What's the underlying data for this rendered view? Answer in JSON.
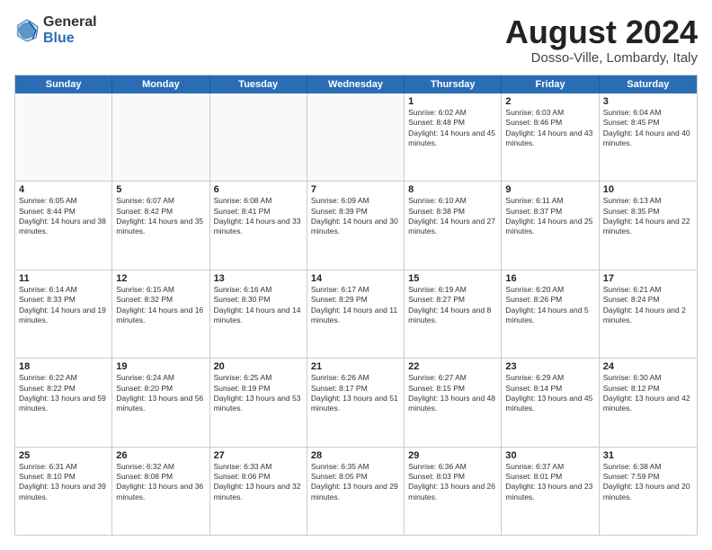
{
  "logo": {
    "general": "General",
    "blue": "Blue"
  },
  "title": {
    "month_year": "August 2024",
    "location": "Dosso-Ville, Lombardy, Italy"
  },
  "days_of_week": [
    "Sunday",
    "Monday",
    "Tuesday",
    "Wednesday",
    "Thursday",
    "Friday",
    "Saturday"
  ],
  "weeks": [
    [
      {
        "day": "",
        "text": ""
      },
      {
        "day": "",
        "text": ""
      },
      {
        "day": "",
        "text": ""
      },
      {
        "day": "",
        "text": ""
      },
      {
        "day": "1",
        "text": "Sunrise: 6:02 AM\nSunset: 8:48 PM\nDaylight: 14 hours and 45 minutes."
      },
      {
        "day": "2",
        "text": "Sunrise: 6:03 AM\nSunset: 8:46 PM\nDaylight: 14 hours and 43 minutes."
      },
      {
        "day": "3",
        "text": "Sunrise: 6:04 AM\nSunset: 8:45 PM\nDaylight: 14 hours and 40 minutes."
      }
    ],
    [
      {
        "day": "4",
        "text": "Sunrise: 6:05 AM\nSunset: 8:44 PM\nDaylight: 14 hours and 38 minutes."
      },
      {
        "day": "5",
        "text": "Sunrise: 6:07 AM\nSunset: 8:42 PM\nDaylight: 14 hours and 35 minutes."
      },
      {
        "day": "6",
        "text": "Sunrise: 6:08 AM\nSunset: 8:41 PM\nDaylight: 14 hours and 33 minutes."
      },
      {
        "day": "7",
        "text": "Sunrise: 6:09 AM\nSunset: 8:39 PM\nDaylight: 14 hours and 30 minutes."
      },
      {
        "day": "8",
        "text": "Sunrise: 6:10 AM\nSunset: 8:38 PM\nDaylight: 14 hours and 27 minutes."
      },
      {
        "day": "9",
        "text": "Sunrise: 6:11 AM\nSunset: 8:37 PM\nDaylight: 14 hours and 25 minutes."
      },
      {
        "day": "10",
        "text": "Sunrise: 6:13 AM\nSunset: 8:35 PM\nDaylight: 14 hours and 22 minutes."
      }
    ],
    [
      {
        "day": "11",
        "text": "Sunrise: 6:14 AM\nSunset: 8:33 PM\nDaylight: 14 hours and 19 minutes."
      },
      {
        "day": "12",
        "text": "Sunrise: 6:15 AM\nSunset: 8:32 PM\nDaylight: 14 hours and 16 minutes."
      },
      {
        "day": "13",
        "text": "Sunrise: 6:16 AM\nSunset: 8:30 PM\nDaylight: 14 hours and 14 minutes."
      },
      {
        "day": "14",
        "text": "Sunrise: 6:17 AM\nSunset: 8:29 PM\nDaylight: 14 hours and 11 minutes."
      },
      {
        "day": "15",
        "text": "Sunrise: 6:19 AM\nSunset: 8:27 PM\nDaylight: 14 hours and 8 minutes."
      },
      {
        "day": "16",
        "text": "Sunrise: 6:20 AM\nSunset: 8:26 PM\nDaylight: 14 hours and 5 minutes."
      },
      {
        "day": "17",
        "text": "Sunrise: 6:21 AM\nSunset: 8:24 PM\nDaylight: 14 hours and 2 minutes."
      }
    ],
    [
      {
        "day": "18",
        "text": "Sunrise: 6:22 AM\nSunset: 8:22 PM\nDaylight: 13 hours and 59 minutes."
      },
      {
        "day": "19",
        "text": "Sunrise: 6:24 AM\nSunset: 8:20 PM\nDaylight: 13 hours and 56 minutes."
      },
      {
        "day": "20",
        "text": "Sunrise: 6:25 AM\nSunset: 8:19 PM\nDaylight: 13 hours and 53 minutes."
      },
      {
        "day": "21",
        "text": "Sunrise: 6:26 AM\nSunset: 8:17 PM\nDaylight: 13 hours and 51 minutes."
      },
      {
        "day": "22",
        "text": "Sunrise: 6:27 AM\nSunset: 8:15 PM\nDaylight: 13 hours and 48 minutes."
      },
      {
        "day": "23",
        "text": "Sunrise: 6:29 AM\nSunset: 8:14 PM\nDaylight: 13 hours and 45 minutes."
      },
      {
        "day": "24",
        "text": "Sunrise: 6:30 AM\nSunset: 8:12 PM\nDaylight: 13 hours and 42 minutes."
      }
    ],
    [
      {
        "day": "25",
        "text": "Sunrise: 6:31 AM\nSunset: 8:10 PM\nDaylight: 13 hours and 39 minutes."
      },
      {
        "day": "26",
        "text": "Sunrise: 6:32 AM\nSunset: 8:08 PM\nDaylight: 13 hours and 36 minutes."
      },
      {
        "day": "27",
        "text": "Sunrise: 6:33 AM\nSunset: 8:06 PM\nDaylight: 13 hours and 32 minutes."
      },
      {
        "day": "28",
        "text": "Sunrise: 6:35 AM\nSunset: 8:05 PM\nDaylight: 13 hours and 29 minutes."
      },
      {
        "day": "29",
        "text": "Sunrise: 6:36 AM\nSunset: 8:03 PM\nDaylight: 13 hours and 26 minutes."
      },
      {
        "day": "30",
        "text": "Sunrise: 6:37 AM\nSunset: 8:01 PM\nDaylight: 13 hours and 23 minutes."
      },
      {
        "day": "31",
        "text": "Sunrise: 6:38 AM\nSunset: 7:59 PM\nDaylight: 13 hours and 20 minutes."
      }
    ]
  ]
}
